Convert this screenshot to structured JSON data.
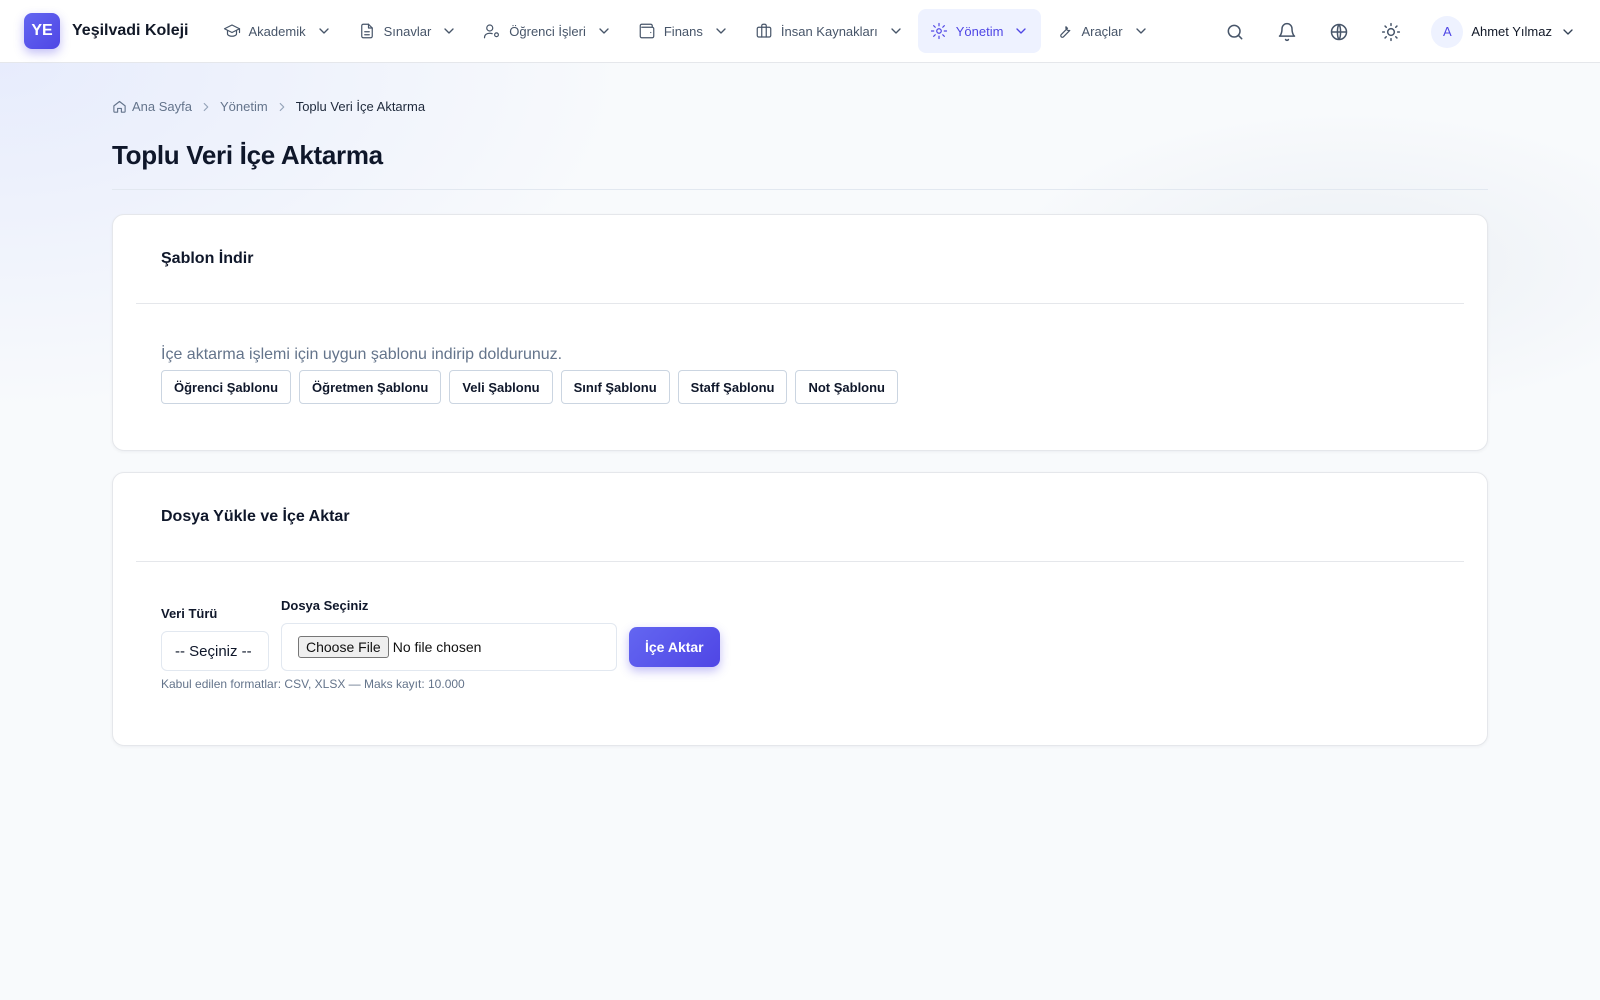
{
  "brand": {
    "logo_text": "YE",
    "name": "Yeşilvadi Koleji",
    "accent": "#4f46e5"
  },
  "nav": {
    "items": [
      {
        "label": "Akademik",
        "icon": "graduation-cap-icon"
      },
      {
        "label": "Sınavlar",
        "icon": "document-icon"
      },
      {
        "label": "Öğrenci İşleri",
        "icon": "user-cog-icon"
      },
      {
        "label": "Finans",
        "icon": "wallet-icon"
      },
      {
        "label": "İnsan Kaynakları",
        "icon": "briefcase-icon"
      },
      {
        "label": "Yönetim",
        "icon": "gear-icon",
        "active": true
      },
      {
        "label": "Araçlar",
        "icon": "wrench-icon"
      }
    ]
  },
  "header_actions": {
    "icons": [
      "search-icon",
      "bell-icon",
      "globe-icon",
      "sun-icon"
    ],
    "user": {
      "initial": "A",
      "name": "Ahmet Yılmaz"
    }
  },
  "breadcrumb": {
    "home": "Ana Sayfa",
    "parent": "Yönetim",
    "current": "Toplu Veri İçe Aktarma"
  },
  "page_title": "Toplu Veri İçe Aktarma",
  "templates_card": {
    "title": "Şablon İndir",
    "hint": "İçe aktarma işlemi için uygun şablonu indirip doldurunuz.",
    "buttons": [
      "Öğrenci Şablonu",
      "Öğretmen Şablonu",
      "Veli Şablonu",
      "Sınıf Şablonu",
      "Staff Şablonu",
      "Not Şablonu"
    ]
  },
  "upload_card": {
    "title": "Dosya Yükle ve İçe Aktar",
    "type_label": "Veri Türü",
    "type_value": "-- Seçiniz --",
    "file_label": "Dosya Seçiniz",
    "file_button": "Choose File",
    "file_status": "No file chosen",
    "submit": "İçe Aktar",
    "help": "Kabul edilen formatlar: CSV, XLSX — Maks kayıt: 10.000"
  }
}
